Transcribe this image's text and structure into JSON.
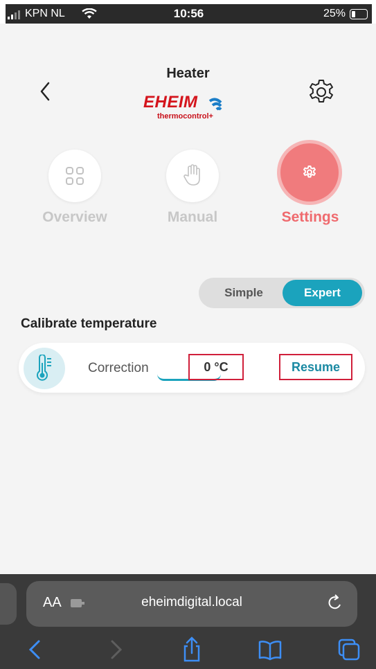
{
  "status_bar": {
    "carrier": "KPN NL",
    "time": "10:56",
    "battery": "25%",
    "battery_level": 0.25
  },
  "header": {
    "title": "Heater",
    "logo_main": "EHEIM",
    "logo_sub": "thermocontrol+",
    "back_icon": "chevron-left-icon",
    "settings_icon": "gear-icon"
  },
  "tabs": [
    {
      "label": "Overview",
      "icon": "grid-icon",
      "active": false
    },
    {
      "label": "Manual",
      "icon": "hand-icon",
      "active": false
    },
    {
      "label": "Settings",
      "icon": "gear-icon",
      "active": true
    }
  ],
  "mode_toggle": {
    "options": [
      "Simple",
      "Expert"
    ],
    "selected": "Expert"
  },
  "calibration": {
    "section_title": "Calibrate temperature",
    "label": "Correction",
    "value": "0 °C",
    "resume": "Resume"
  },
  "browser": {
    "text_size": "AA",
    "url": "eheimdigital.local"
  },
  "colors": {
    "accent_teal": "#1ba3bd",
    "active_red": "#f07b7d",
    "highlight_box": "#d01f3a",
    "brand_red": "#d4141c"
  }
}
